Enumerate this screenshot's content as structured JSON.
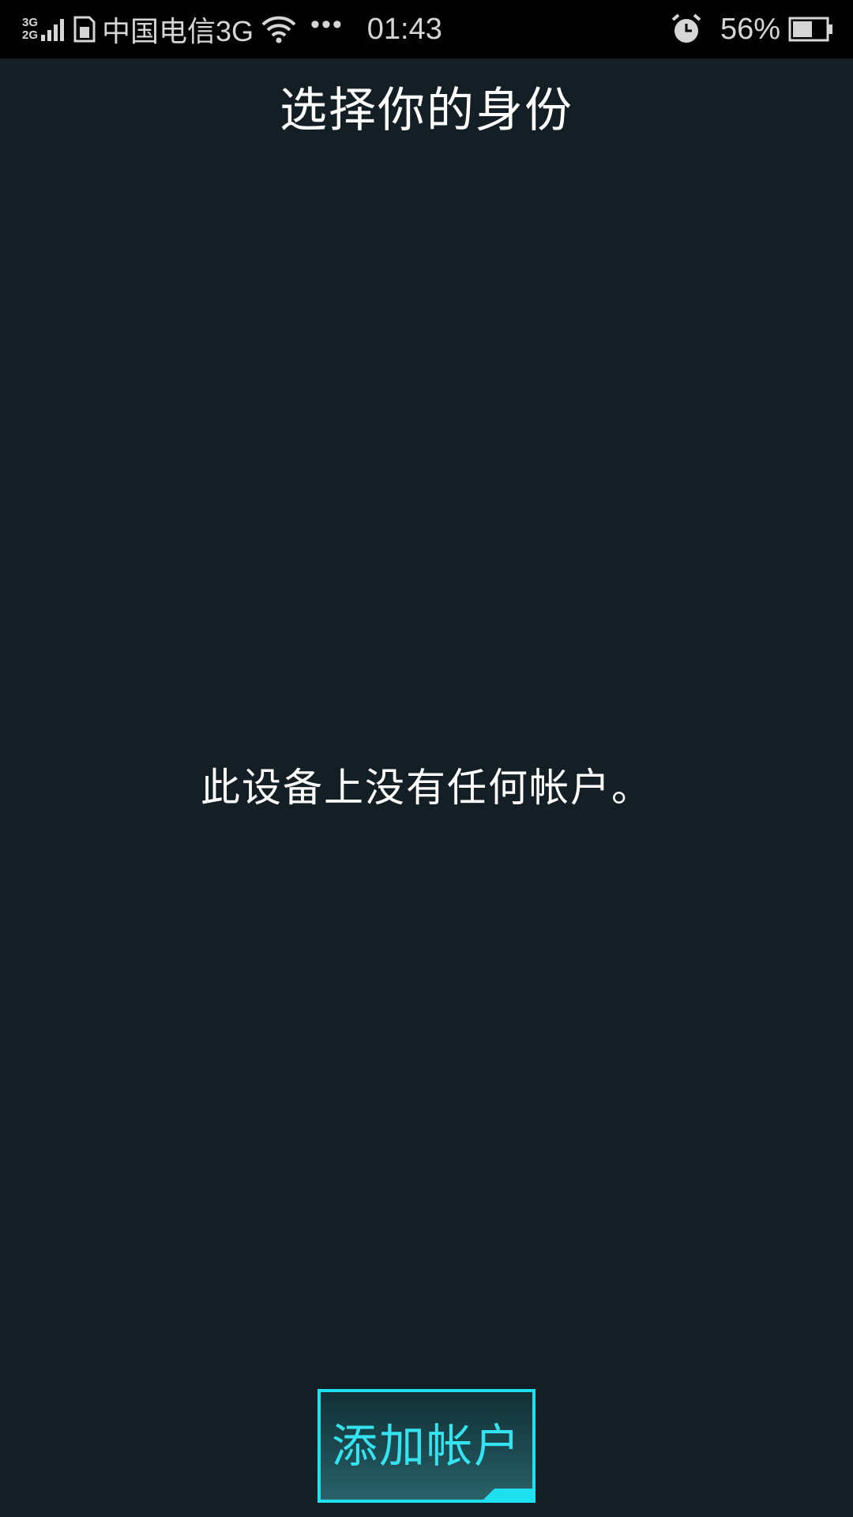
{
  "status_bar": {
    "network_type_top": "3G",
    "network_type_bottom": "2G",
    "carrier": "中国电信3G",
    "more_indicator": "•••",
    "time": "01:43",
    "battery_percent": "56%",
    "icons": [
      "signal-icon",
      "sim-icon",
      "wifi-icon",
      "more-icon",
      "alarm-icon",
      "battery-icon"
    ]
  },
  "header": {
    "title": "选择你的身份"
  },
  "main": {
    "empty_message": "此设备上没有任何帐户。"
  },
  "actions": {
    "add_account_label": "添加帐户"
  },
  "colors": {
    "background": "#131f24",
    "status_bar": "#000000",
    "accent": "#1fe0ee",
    "text": "#ffffff"
  }
}
